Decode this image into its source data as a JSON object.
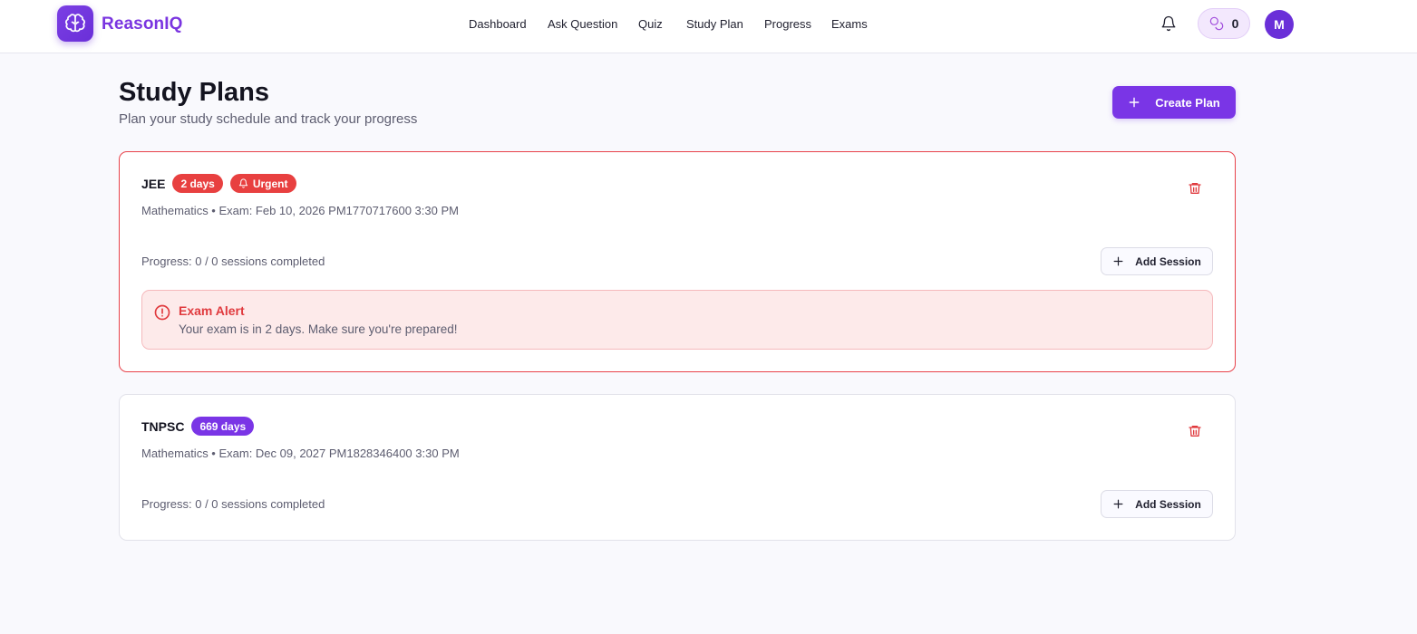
{
  "app": {
    "name": "ReasonIQ",
    "logo_icon": "brain-icon"
  },
  "nav": {
    "items": [
      {
        "label": "Dashboard"
      },
      {
        "label": "Ask Question"
      },
      {
        "label": "Quiz"
      },
      {
        "label": "Study Plan"
      },
      {
        "label": "Progress"
      },
      {
        "label": "Exams"
      }
    ]
  },
  "header": {
    "notification_icon": "bell-icon",
    "points": {
      "icon": "coins-icon",
      "value": "0"
    },
    "avatar_initial": "M"
  },
  "page": {
    "title": "Study Plans",
    "subtitle": "Plan your study schedule and track your progress",
    "create_button": {
      "icon": "plus-icon",
      "label": "Create Plan"
    }
  },
  "plans": [
    {
      "name": "JEE",
      "days_badge": "2 days",
      "urgent_badge": "Urgent",
      "meta": "Mathematics • Exam: Feb 10, 2026 PM1770717600 3:30 PM",
      "progress": "Progress: 0 / 0 sessions completed",
      "add_session_label": "Add Session",
      "alert": {
        "title": "Exam Alert",
        "message": "Your exam is in 2 days. Make sure you're prepared!"
      }
    },
    {
      "name": "TNPSC",
      "days_badge": "669 days",
      "meta": "Mathematics • Exam: Dec 09, 2027 PM1828346400 3:30 PM",
      "progress": "Progress: 0 / 0 sessions completed",
      "add_session_label": "Add Session"
    }
  ],
  "colors": {
    "accent": "#7a35e6",
    "urgent": "#e84040",
    "alert_bg": "#fdeaea"
  }
}
